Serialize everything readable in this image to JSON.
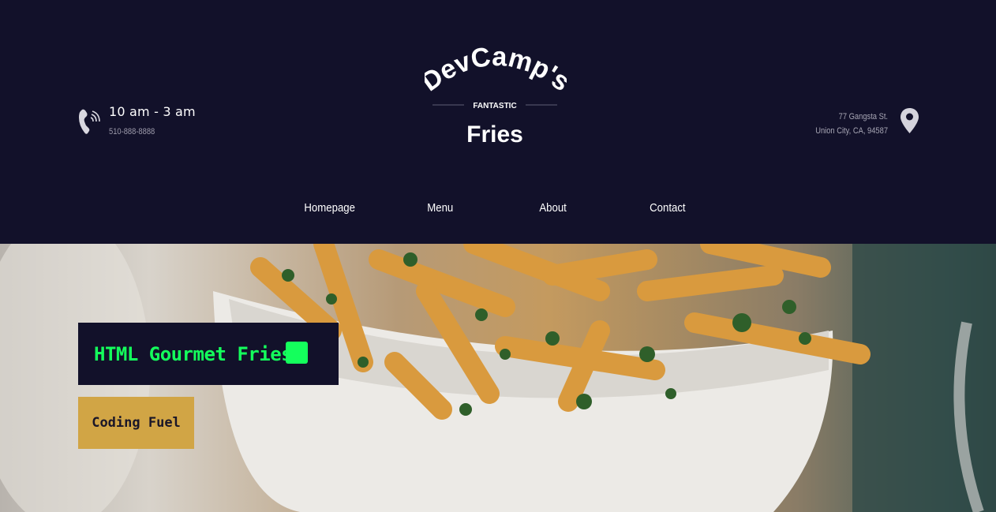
{
  "header": {
    "hours": "10 am - 3 am",
    "phone": "510-888-8888",
    "logo": {
      "line1": "DevCamp's",
      "line2": "FANTASTIC",
      "line3": "Fries"
    },
    "address_line1": "77 Gangsta St.",
    "address_line2": "Union City, CA, 94587"
  },
  "nav": {
    "items": [
      {
        "label": "Homepage"
      },
      {
        "label": "Menu"
      },
      {
        "label": "About"
      },
      {
        "label": "Contact"
      }
    ]
  },
  "hero": {
    "title": "HTML Gourmet Fries",
    "button_label": "Coding Fuel"
  },
  "colors": {
    "background": "#12112a",
    "accent_green": "#14ff5c",
    "button_gold": "#d1a545"
  },
  "icons": [
    "phone-icon",
    "map-pin-icon",
    "fry-icon"
  ]
}
